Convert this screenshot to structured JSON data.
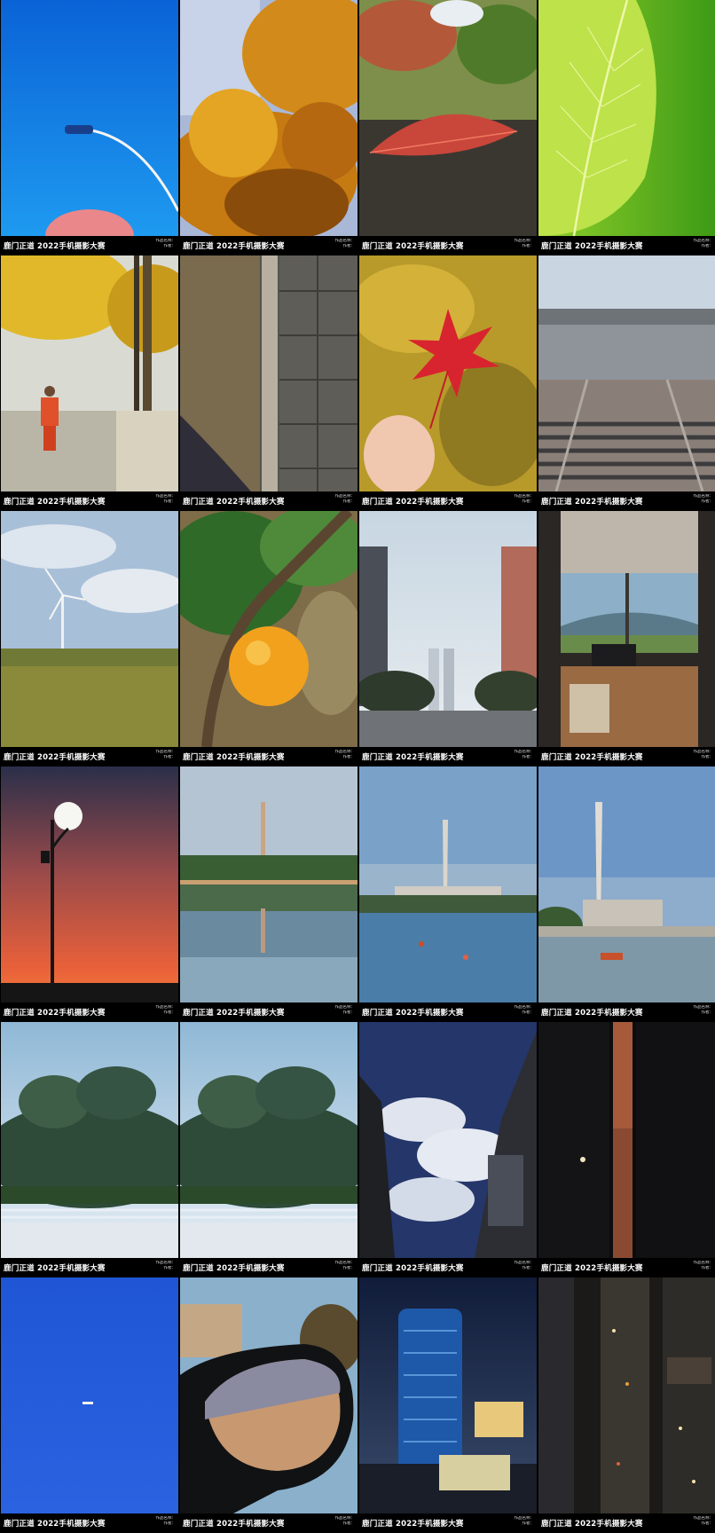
{
  "caption_title": "鹿门正道 2022手机摄影大赛",
  "photos": [
    {
      "subject": "blue sky street lamp",
      "info": [
        "作品名称：",
        "作者："
      ]
    },
    {
      "subject": "autumn ginkgo tree",
      "info": [
        "作品名称：",
        "作者："
      ]
    },
    {
      "subject": "red leaf on ground",
      "info": [
        "作品名称：",
        "作者："
      ]
    },
    {
      "subject": "green leaf closeup",
      "info": [
        "作品名称：",
        "作者："
      ]
    },
    {
      "subject": "street sweeper under ginkgo",
      "info": [
        "作品名称：",
        "作者："
      ]
    },
    {
      "subject": "fallen leaves on pavement",
      "info": [
        "作品名称：",
        "作者："
      ]
    },
    {
      "subject": "hand holding maple leaf",
      "info": [
        "作品名称：",
        "作者："
      ]
    },
    {
      "subject": "sea and stone steps",
      "info": [
        "作品名称：",
        "作者："
      ]
    },
    {
      "subject": "wind turbine over wheat field",
      "info": [
        "作品名称：",
        "作者："
      ]
    },
    {
      "subject": "orange on tree",
      "info": [
        "作品名称：",
        "作者："
      ]
    },
    {
      "subject": "city street with towers",
      "info": [
        "作品名称：",
        "作者："
      ]
    },
    {
      "subject": "office window view",
      "info": [
        "作品名称：",
        "作者："
      ]
    },
    {
      "subject": "street lamp at sunset",
      "info": [
        "作品名称：",
        "作者："
      ]
    },
    {
      "subject": "tower reflected in lake",
      "info": [
        "作品名称：",
        "作者："
      ]
    },
    {
      "subject": "canton tower over river",
      "info": [
        "作品名称：",
        "作者："
      ]
    },
    {
      "subject": "canton tower skyline",
      "info": [
        "作品名称：",
        "作者："
      ]
    },
    {
      "subject": "palm trees and fence",
      "info": [
        "作品名称：",
        "作者："
      ]
    },
    {
      "subject": "palm trees and fence copy",
      "info": [
        "作品名称：",
        "作者："
      ]
    },
    {
      "subject": "clouds between buildings",
      "info": [
        "作品名称：",
        "作者："
      ]
    },
    {
      "subject": "dark alley at dusk",
      "info": [
        "作品名称：",
        "作者："
      ]
    },
    {
      "subject": "airplane in blue sky",
      "info": [
        "作品名称：",
        "作者："
      ]
    },
    {
      "subject": "car side mirror",
      "info": [
        "作品名称：",
        "作者："
      ]
    },
    {
      "subject": "glass tower at night",
      "info": [
        "作品名称：",
        "作者："
      ]
    },
    {
      "subject": "aerial night traffic",
      "info": [
        "作品名称：",
        "作者："
      ]
    }
  ]
}
